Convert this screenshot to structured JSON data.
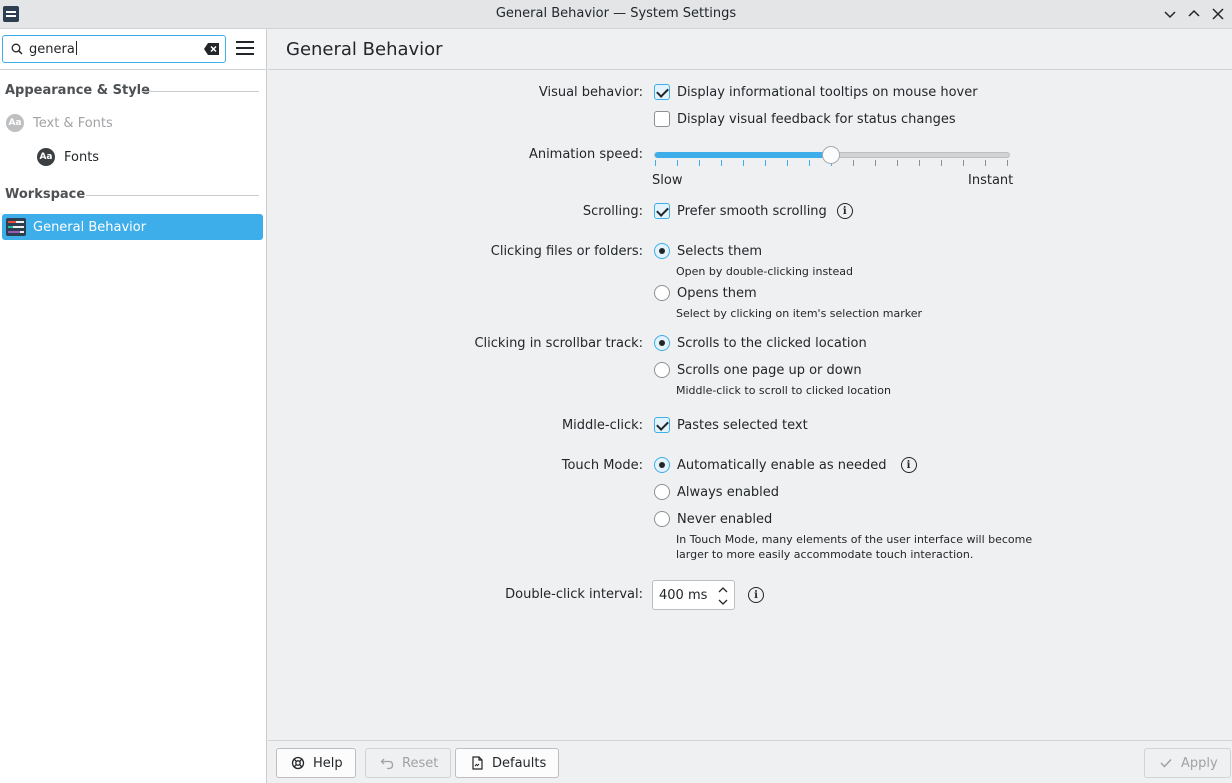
{
  "window": {
    "title": "General Behavior — System Settings"
  },
  "sidebar": {
    "search_value": "genera",
    "sections": [
      {
        "heading": "Appearance & Style"
      },
      {
        "heading": "Workspace"
      }
    ],
    "items": [
      {
        "label": "Text & Fonts",
        "icon": "aa-icon"
      },
      {
        "label": "Fonts",
        "icon": "aa-icon"
      },
      {
        "label": "General Behavior",
        "icon": "general-behavior-icon",
        "selected": true
      }
    ]
  },
  "header": {
    "title": "General Behavior"
  },
  "settings": {
    "visual_behavior": {
      "label": "Visual behavior:",
      "options": [
        {
          "label": "Display informational tooltips on mouse hover",
          "checked": true
        },
        {
          "label": "Display visual feedback for status changes",
          "checked": false
        }
      ]
    },
    "animation_speed": {
      "label": "Animation speed:",
      "min_label": "Slow",
      "max_label": "Instant",
      "value_fraction": 0.5
    },
    "scrolling": {
      "label": "Scrolling:",
      "option": "Prefer smooth scrolling",
      "checked": true
    },
    "clicking_files": {
      "label": "Clicking files or folders:",
      "options": [
        {
          "label": "Selects them",
          "hint": "Open by double-clicking instead",
          "selected": true
        },
        {
          "label": "Opens them",
          "hint": "Select by clicking on item's selection marker",
          "selected": false
        }
      ]
    },
    "scrollbar_track": {
      "label": "Clicking in scrollbar track:",
      "options": [
        {
          "label": "Scrolls to the clicked location",
          "selected": true
        },
        {
          "label": "Scrolls one page up or down",
          "hint": "Middle-click to scroll to clicked location",
          "selected": false
        }
      ]
    },
    "middle_click": {
      "label": "Middle-click:",
      "option": "Pastes selected text",
      "checked": true
    },
    "touch_mode": {
      "label": "Touch Mode:",
      "options": [
        {
          "label": "Automatically enable as needed",
          "selected": true
        },
        {
          "label": "Always enabled",
          "selected": false
        },
        {
          "label": "Never enabled",
          "selected": false
        }
      ],
      "hint_line1": "In Touch Mode, many elements of the user interface will become",
      "hint_line2": "larger to more easily accommodate touch interaction."
    },
    "double_click": {
      "label": "Double-click interval:",
      "value": "400 ms"
    }
  },
  "footer": {
    "help": "Help",
    "reset": "Reset",
    "defaults": "Defaults",
    "apply": "Apply"
  },
  "colors": {
    "accent": "#3daee9",
    "window_bg": "#eff0f1",
    "sidebar_bg": "#ffffff"
  }
}
